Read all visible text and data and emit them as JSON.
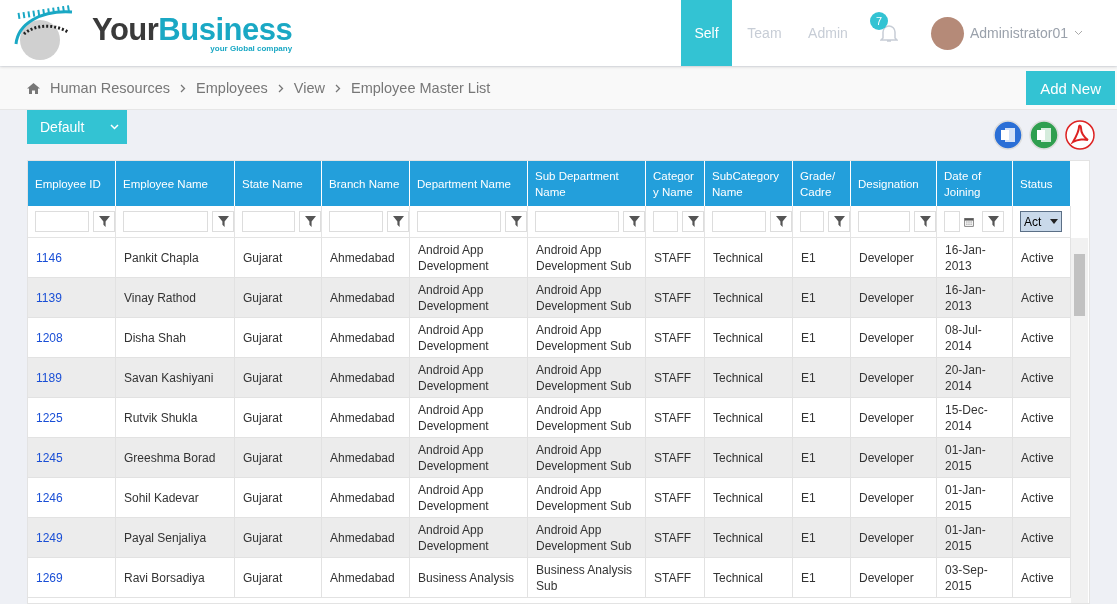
{
  "brand": {
    "name_parts": [
      "Your",
      "Business"
    ],
    "tagline": "your Global company"
  },
  "nav": [
    {
      "label": "Self",
      "selected": true
    },
    {
      "label": "Team",
      "selected": false
    },
    {
      "label": "Admin",
      "selected": false
    }
  ],
  "notifications": {
    "count": "7"
  },
  "user": {
    "name": "Administrator01"
  },
  "breadcrumb": [
    "Human Resources",
    "Employees",
    "View",
    "Employee Master List"
  ],
  "add_button": "Add New",
  "view_select": {
    "value": "Default"
  },
  "exports": [
    {
      "kind": "word"
    },
    {
      "kind": "excel"
    },
    {
      "kind": "pdf"
    }
  ],
  "table": {
    "columns": [
      {
        "label": "Employee ID",
        "kind": "text"
      },
      {
        "label": "Employee Name",
        "kind": "text"
      },
      {
        "label": "State Name",
        "kind": "text"
      },
      {
        "label": "Branch Name",
        "kind": "text"
      },
      {
        "label": "Department Name",
        "kind": "text"
      },
      {
        "label": "Sub Department Name",
        "kind": "text"
      },
      {
        "label": "Category Name",
        "kind": "text"
      },
      {
        "label": "SubCategory Name",
        "kind": "text"
      },
      {
        "label": "Grade/ Cadre",
        "kind": "text"
      },
      {
        "label": "Designation",
        "kind": "text"
      },
      {
        "label": "Date of Joining",
        "kind": "date"
      },
      {
        "label": "Status",
        "kind": "select",
        "value": "Act"
      }
    ],
    "rows": [
      [
        "1146",
        "Pankit Chapla",
        "Gujarat",
        "Ahmedabad",
        "Android App Development",
        "Android App Development Sub",
        "STAFF",
        "Technical",
        "E1",
        "Developer",
        "16-Jan-2013",
        "Active"
      ],
      [
        "1139",
        "Vinay Rathod",
        "Gujarat",
        "Ahmedabad",
        "Android App Development",
        "Android App Development Sub",
        "STAFF",
        "Technical",
        "E1",
        "Developer",
        "16-Jan-2013",
        "Active"
      ],
      [
        "1208",
        "Disha Shah",
        "Gujarat",
        "Ahmedabad",
        "Android App Development",
        "Android App Development Sub",
        "STAFF",
        "Technical",
        "E1",
        "Developer",
        "08-Jul-2014",
        "Active"
      ],
      [
        "1189",
        "Savan Kashiyani",
        "Gujarat",
        "Ahmedabad",
        "Android App Development",
        "Android App Development Sub",
        "STAFF",
        "Technical",
        "E1",
        "Developer",
        "20-Jan-2014",
        "Active"
      ],
      [
        "1225",
        "Rutvik Shukla",
        "Gujarat",
        "Ahmedabad",
        "Android App Development",
        "Android App Development Sub",
        "STAFF",
        "Technical",
        "E1",
        "Developer",
        "15-Dec-2014",
        "Active"
      ],
      [
        "1245",
        "Greeshma Borad",
        "Gujarat",
        "Ahmedabad",
        "Android App Development",
        "Android App Development Sub",
        "STAFF",
        "Technical",
        "E1",
        "Developer",
        "01-Jan-2015",
        "Active"
      ],
      [
        "1246",
        "Sohil Kadevar",
        "Gujarat",
        "Ahmedabad",
        "Android App Development",
        "Android App Development Sub",
        "STAFF",
        "Technical",
        "E1",
        "Developer",
        "01-Jan-2015",
        "Active"
      ],
      [
        "1249",
        "Payal Senjaliya",
        "Gujarat",
        "Ahmedabad",
        "Android App Development",
        "Android App Development Sub",
        "STAFF",
        "Technical",
        "E1",
        "Developer",
        "01-Jan-2015",
        "Active"
      ],
      [
        "1269",
        "Ravi Borsadiya",
        "Gujarat",
        "Ahmedabad",
        "Business Analysis",
        "Business Analysis Sub",
        "STAFF",
        "Technical",
        "E1",
        "Developer",
        "03-Sep-2015",
        "Active"
      ]
    ]
  }
}
